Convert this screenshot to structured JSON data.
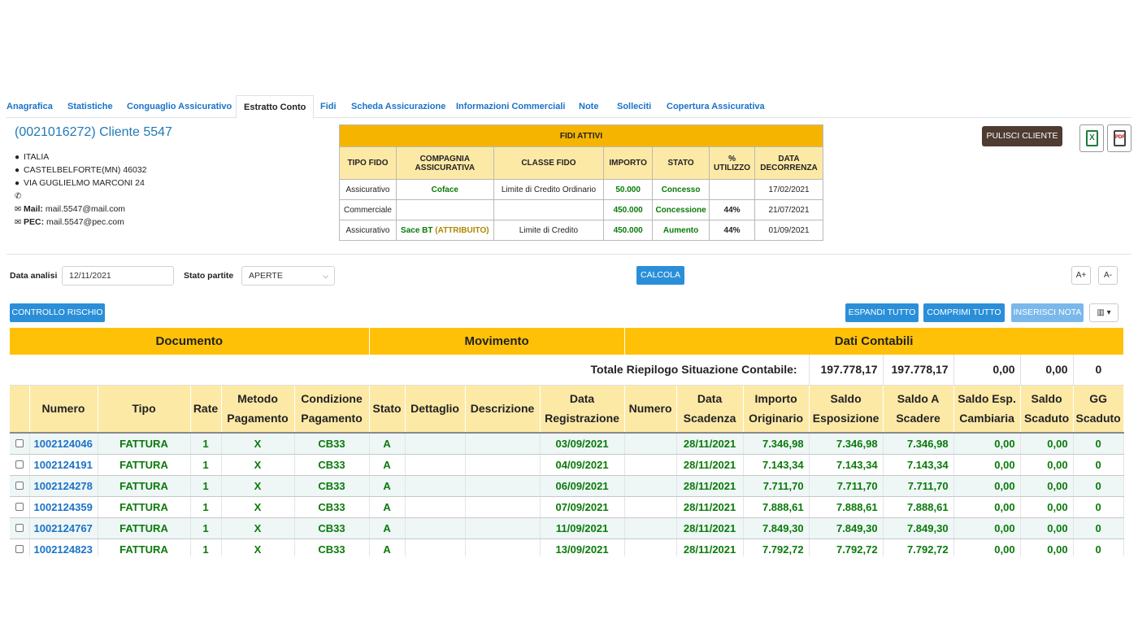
{
  "tabs": [
    {
      "label": "Anagrafica",
      "active": false
    },
    {
      "label": "Statistiche",
      "active": false
    },
    {
      "label": "Conguaglio Assicurativo",
      "active": false
    },
    {
      "label": "Estratto Conto",
      "active": true
    },
    {
      "label": "Fidi",
      "active": false
    },
    {
      "label": "Scheda Assicurazione",
      "active": false
    },
    {
      "label": "Informazioni Commerciali",
      "active": false
    },
    {
      "label": "Note",
      "active": false
    },
    {
      "label": "Solleciti",
      "active": false
    },
    {
      "label": "Copertura Assicurativa",
      "active": false
    }
  ],
  "client": {
    "title": "(0021016272) Cliente 5547",
    "country": "ITALIA",
    "city": "CASTELBELFORTE(MN) 46032",
    "address": "VIA GUGLIELMO MARCONI 24",
    "phone": "",
    "mail_label": "Mail:",
    "mail": "mail.5547@mail.com",
    "pec_label": "PEC:",
    "pec": "mail.5547@pec.com"
  },
  "fidi": {
    "caption": "FIDI ATTIVI",
    "headers": [
      "TIPO FIDO",
      "COMPAGNIA ASSICURATIVA",
      "CLASSE FIDO",
      "IMPORTO",
      "STATO",
      "% UTILIZZO",
      "DATA DECORRENZA"
    ],
    "rows": [
      {
        "tipo": "Assicurativo",
        "compagnia": "Coface",
        "compagnia_extra": "",
        "classe": "Limite di Credito Ordinario",
        "importo": "50.000",
        "stato": "Concesso",
        "utilizzo": "",
        "data": "17/02/2021"
      },
      {
        "tipo": "Commerciale",
        "compagnia": "",
        "compagnia_extra": "",
        "classe": "",
        "importo": "450.000",
        "stato": "Concessione",
        "utilizzo": "44%",
        "data": "21/07/2021"
      },
      {
        "tipo": "Assicurativo",
        "compagnia": "Sace BT",
        "compagnia_extra": "(ATTRIBUITO)",
        "classe": "Limite di Credito",
        "importo": "450.000",
        "stato": "Aumento",
        "utilizzo": "44%",
        "data": "01/09/2021"
      }
    ]
  },
  "actions": {
    "pulisci": "PULISCI CLIENTE",
    "excel_icon": "X",
    "pdf_icon": "PDF"
  },
  "filters": {
    "data_label": "Data analisi",
    "data_value": "12/11/2021",
    "stato_label": "Stato partite",
    "stato_value": "APERTE",
    "calcola": "CALCOLA",
    "font_plus": "A+",
    "font_minus": "A-"
  },
  "toolbar": {
    "controllo": "CONTROLLO RISCHIO",
    "espandi": "ESPANDI TUTTO",
    "comprimi": "COMPRIMI TUTTO",
    "inserisci": "INSERISCI NOTA"
  },
  "grid": {
    "groups": [
      "Documento",
      "Movimento",
      "Dati Contabili"
    ],
    "totals_label": "Totale Riepilogo Situazione Contabile:",
    "totals": [
      "197.778,17",
      "197.778,17",
      "0,00",
      "0,00",
      "0"
    ],
    "headers": [
      "",
      "Numero",
      "Tipo",
      "Rate",
      "Metodo Pagamento",
      "Condizione Pagamento",
      "Stato",
      "Dettaglio",
      "Descrizione",
      "Data Registrazione",
      "Numero",
      "Data Scadenza",
      "Importo Originario",
      "Saldo Esposizione",
      "Saldo A Scadere",
      "Saldo Esp. Cambiaria",
      "Saldo Scaduto",
      "GG Scaduto"
    ],
    "rows": [
      [
        "1002124046",
        "FATTURA",
        "1",
        "X",
        "CB33",
        "A",
        "",
        "",
        "03/09/2021",
        "",
        "28/11/2021",
        "7.346,98",
        "7.346,98",
        "7.346,98",
        "0,00",
        "0,00",
        "0"
      ],
      [
        "1002124191",
        "FATTURA",
        "1",
        "X",
        "CB33",
        "A",
        "",
        "",
        "04/09/2021",
        "",
        "28/11/2021",
        "7.143,34",
        "7.143,34",
        "7.143,34",
        "0,00",
        "0,00",
        "0"
      ],
      [
        "1002124278",
        "FATTURA",
        "1",
        "X",
        "CB33",
        "A",
        "",
        "",
        "06/09/2021",
        "",
        "28/11/2021",
        "7.711,70",
        "7.711,70",
        "7.711,70",
        "0,00",
        "0,00",
        "0"
      ],
      [
        "1002124359",
        "FATTURA",
        "1",
        "X",
        "CB33",
        "A",
        "",
        "",
        "07/09/2021",
        "",
        "28/11/2021",
        "7.888,61",
        "7.888,61",
        "7.888,61",
        "0,00",
        "0,00",
        "0"
      ],
      [
        "1002124767",
        "FATTURA",
        "1",
        "X",
        "CB33",
        "A",
        "",
        "",
        "11/09/2021",
        "",
        "28/11/2021",
        "7.849,30",
        "7.849,30",
        "7.849,30",
        "0,00",
        "0,00",
        "0"
      ],
      [
        "1002124823",
        "FATTURA",
        "1",
        "X",
        "CB33",
        "A",
        "",
        "",
        "13/09/2021",
        "",
        "28/11/2021",
        "7.792,72",
        "7.792,72",
        "7.792,72",
        "0,00",
        "0,00",
        "0"
      ]
    ]
  }
}
